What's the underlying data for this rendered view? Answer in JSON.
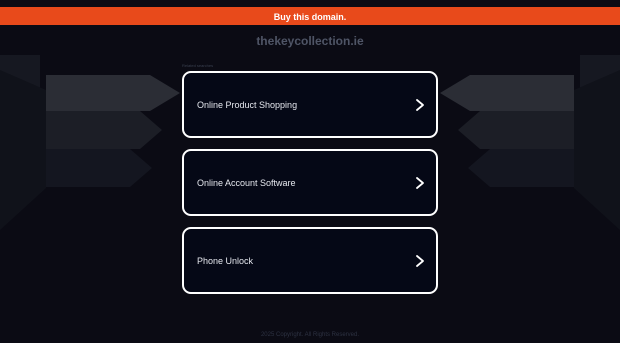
{
  "banner": {
    "label": "Buy this domain."
  },
  "domain": {
    "name": "thekeycollection.ie"
  },
  "related": {
    "label": "Related searches"
  },
  "links": [
    {
      "label": "Online Product Shopping",
      "icon": "chevron-right-icon"
    },
    {
      "label": "Online Account Software",
      "icon": "chevron-right-icon"
    },
    {
      "label": "Phone Unlock",
      "icon": "chevron-right-icon"
    }
  ],
  "footer": {
    "text": "2025 Copyright. All Rights Reserved."
  },
  "colors": {
    "background": "#0b0b14",
    "banner": "#e84a1b",
    "card_border": "#ffffff",
    "card_background": "#050816"
  }
}
